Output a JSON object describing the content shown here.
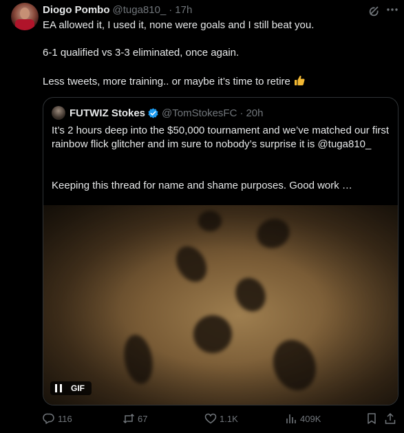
{
  "author": {
    "name": "Diogo Pombo",
    "handle": "@tuga810_",
    "time": "17h"
  },
  "text": {
    "line1": "EA allowed it, I used it, none were goals and I still beat you.",
    "line2": "6-1 qualified vs 3-3 eliminated, once again.",
    "line3": "Less tweets, more training.. or maybe it’s time to retire",
    "emoji": "thumbs-up-icon"
  },
  "quoted": {
    "name": "FUTWIZ Stokes",
    "handle": "@TomStokesFC",
    "time": "20h",
    "verified": true,
    "para1": "It’s 2 hours deep into the $50,000 tournament and we’ve matched our first rainbow flick glitcher and im sure to nobody’s surprise it is @tuga810_",
    "para2": "Keeping this thread for name and shame purposes. Good work …",
    "media_label": "GIF"
  },
  "actions": {
    "replies": "116",
    "retweets": "67",
    "likes": "1.1K",
    "views": "409K"
  },
  "colors": {
    "background": "#000000",
    "text": "#e7e9ea",
    "muted": "#71767b",
    "verified": "#1d9bf0",
    "border": "#2f3336"
  }
}
